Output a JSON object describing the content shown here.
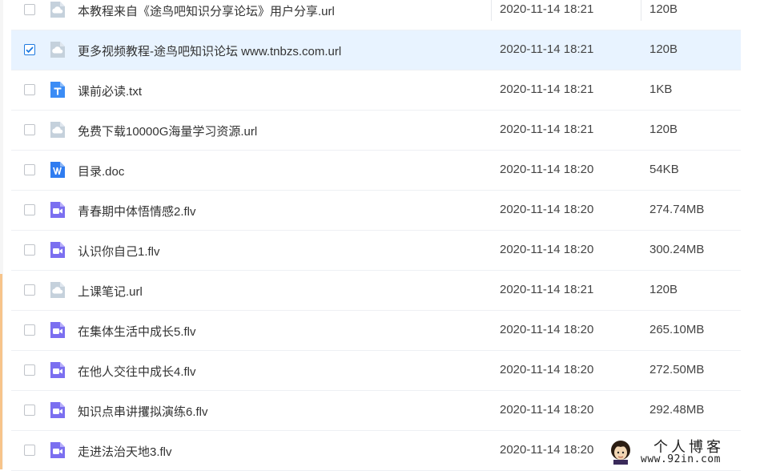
{
  "files": [
    {
      "name": "本教程来自《途鸟吧知识分享论坛》用户分享.url",
      "date": "2020-11-14 18:21",
      "size": "120B",
      "type": "url",
      "checked": false
    },
    {
      "name": "更多视频教程-途鸟吧知识论坛 www.tnbzs.com.url",
      "date": "2020-11-14 18:21",
      "size": "120B",
      "type": "url",
      "checked": true
    },
    {
      "name": "课前必读.txt",
      "date": "2020-11-14 18:21",
      "size": "1KB",
      "type": "txt",
      "checked": false
    },
    {
      "name": "免费下载10000G海量学习资源.url",
      "date": "2020-11-14 18:21",
      "size": "120B",
      "type": "url",
      "checked": false
    },
    {
      "name": "目录.doc",
      "date": "2020-11-14 18:20",
      "size": "54KB",
      "type": "doc",
      "checked": false
    },
    {
      "name": "青春期中体悟情感2.flv",
      "date": "2020-11-14 18:20",
      "size": "274.74MB",
      "type": "video",
      "checked": false
    },
    {
      "name": "认识你自己1.flv",
      "date": "2020-11-14 18:20",
      "size": "300.24MB",
      "type": "video",
      "checked": false
    },
    {
      "name": "上课笔记.url",
      "date": "2020-11-14 18:21",
      "size": "120B",
      "type": "url",
      "checked": false
    },
    {
      "name": "在集体生活中成长5.flv",
      "date": "2020-11-14 18:20",
      "size": "265.10MB",
      "type": "video",
      "checked": false
    },
    {
      "name": "在他人交往中成长4.flv",
      "date": "2020-11-14 18:20",
      "size": "272.50MB",
      "type": "video",
      "checked": false
    },
    {
      "name": "知识点串讲攫拟演练6.flv",
      "date": "2020-11-14 18:20",
      "size": "292.48MB",
      "type": "video",
      "checked": false
    },
    {
      "name": "走进法治天地3.flv",
      "date": "2020-11-14 18:20",
      "size": "",
      "type": "video",
      "checked": false
    }
  ],
  "icons": {
    "url": "cloud-link-icon",
    "txt": "text-file-icon",
    "doc": "word-doc-icon",
    "video": "video-file-icon"
  },
  "colors": {
    "selected_row": "#e8f3ff",
    "checkbox_checked": "#1f7ae0",
    "url_icon": "#c5d1dc",
    "txt_icon": "#3b8cf5",
    "doc_icon": "#2f7cf0",
    "video_icon": "#7b6ff0"
  },
  "watermark": {
    "title": "个人博客",
    "url": "www.92in.com"
  }
}
